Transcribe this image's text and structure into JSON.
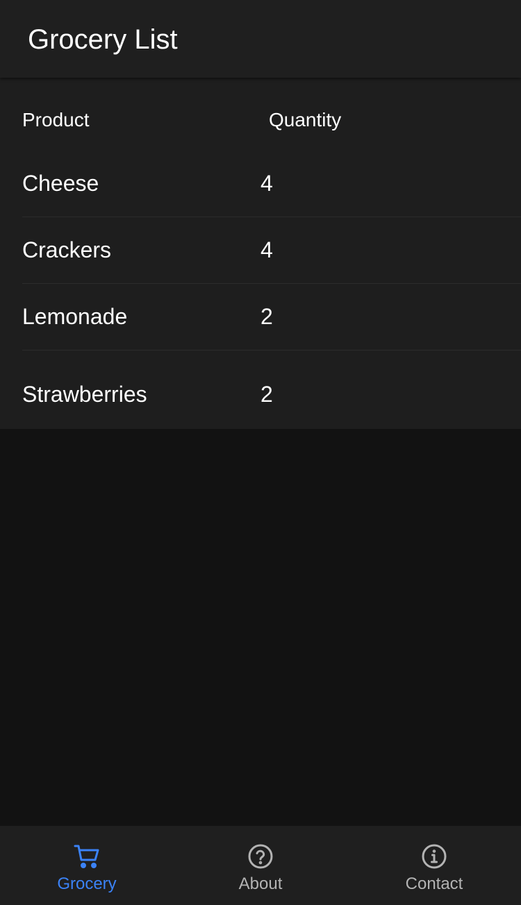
{
  "header": {
    "title": "Grocery List"
  },
  "table": {
    "columns": [
      "Product",
      "Quantity"
    ],
    "rows": [
      {
        "product": "Cheese",
        "quantity": "4"
      },
      {
        "product": "Crackers",
        "quantity": "4"
      },
      {
        "product": "Lemonade",
        "quantity": "2"
      },
      {
        "product": "Strawberries",
        "quantity": "2"
      }
    ]
  },
  "nav": {
    "active": "grocery",
    "items": [
      {
        "id": "grocery",
        "label": "Grocery",
        "icon": "cart-icon"
      },
      {
        "id": "about",
        "label": "About",
        "icon": "question-circle-icon"
      },
      {
        "id": "contact",
        "label": "Contact",
        "icon": "info-circle-icon"
      }
    ]
  },
  "colors": {
    "background": "#121212",
    "surface": "#1f1f1f",
    "accent": "#3b82f6",
    "inactive": "#b3b3b3"
  }
}
